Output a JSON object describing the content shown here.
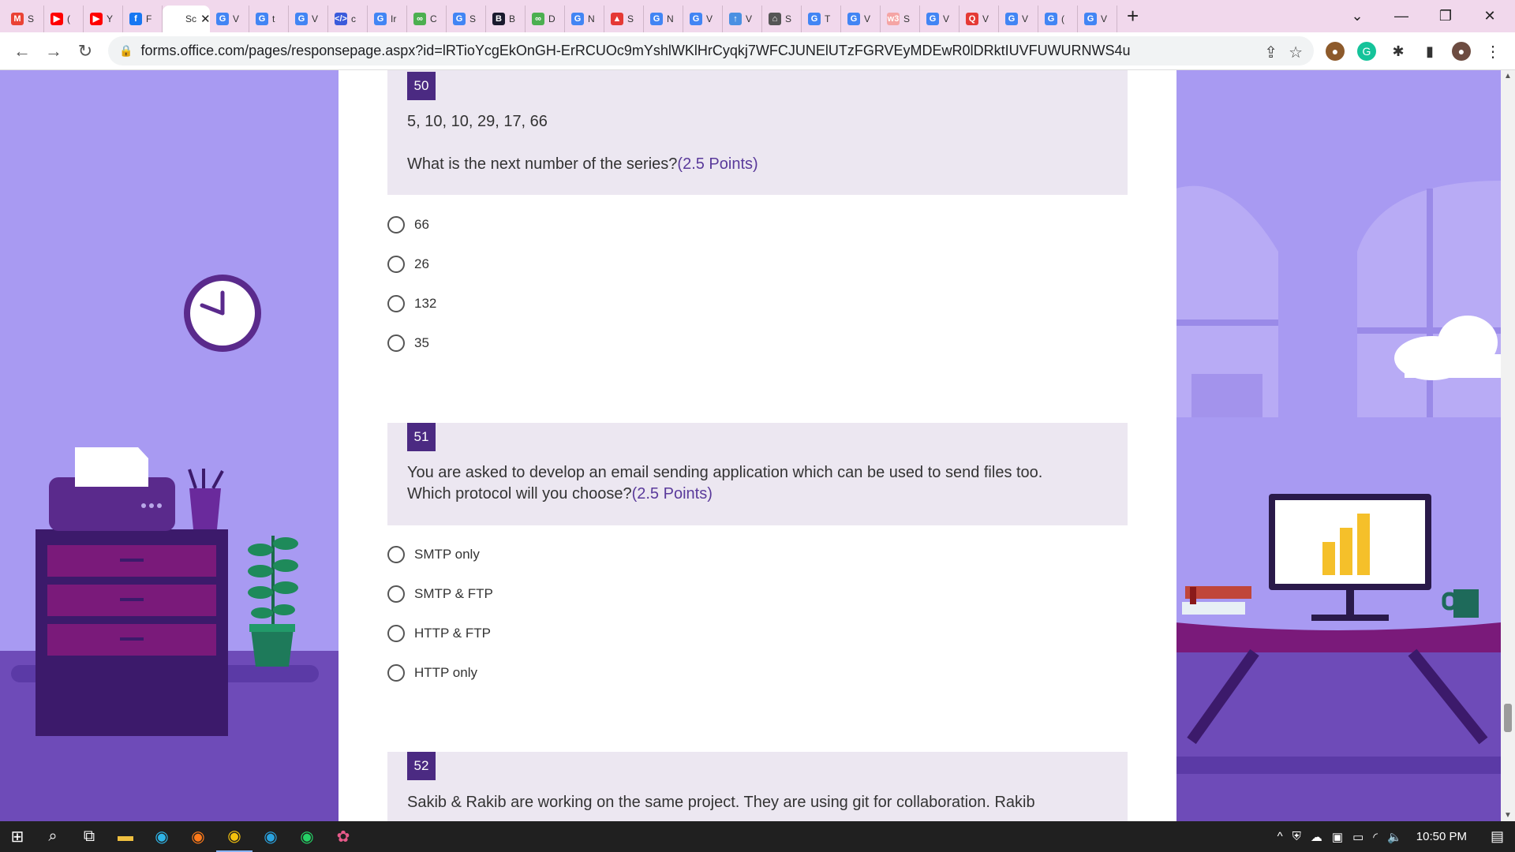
{
  "browser": {
    "tabs": [
      {
        "fav": "M",
        "color": "#ea4335",
        "label": "S"
      },
      {
        "fav": "▶",
        "color": "#ff0000",
        "label": "("
      },
      {
        "fav": "▶",
        "color": "#ff0000",
        "label": "Y"
      },
      {
        "fav": "f",
        "color": "#1877f2",
        "label": "F"
      },
      {
        "fav": "",
        "color": "#ffffff",
        "label": "Sc",
        "active": true
      },
      {
        "fav": "G",
        "color": "#4285f4",
        "label": "V"
      },
      {
        "fav": "G",
        "color": "#4285f4",
        "label": "t"
      },
      {
        "fav": "G",
        "color": "#4285f4",
        "label": "V"
      },
      {
        "fav": "</>",
        "color": "#3b5bdb",
        "label": "c"
      },
      {
        "fav": "G",
        "color": "#4285f4",
        "label": "Ir"
      },
      {
        "fav": "∞",
        "color": "#4caf50",
        "label": "C"
      },
      {
        "fav": "G",
        "color": "#4285f4",
        "label": "S"
      },
      {
        "fav": "B",
        "color": "#1a1a2e",
        "label": "B"
      },
      {
        "fav": "∞",
        "color": "#4caf50",
        "label": "D"
      },
      {
        "fav": "G",
        "color": "#4285f4",
        "label": "N"
      },
      {
        "fav": "▲",
        "color": "#e53935",
        "label": "S"
      },
      {
        "fav": "G",
        "color": "#4285f4",
        "label": "N"
      },
      {
        "fav": "G",
        "color": "#4285f4",
        "label": "V"
      },
      {
        "fav": "↑",
        "color": "#4a90e2",
        "label": "V"
      },
      {
        "fav": "⌂",
        "color": "#555555",
        "label": "S"
      },
      {
        "fav": "G",
        "color": "#4285f4",
        "label": "T"
      },
      {
        "fav": "G",
        "color": "#4285f4",
        "label": "V"
      },
      {
        "fav": "w3",
        "color": "#f5a5a5",
        "label": "S"
      },
      {
        "fav": "G",
        "color": "#4285f4",
        "label": "V"
      },
      {
        "fav": "Q",
        "color": "#e53935",
        "label": "V"
      },
      {
        "fav": "G",
        "color": "#4285f4",
        "label": "V"
      },
      {
        "fav": "G",
        "color": "#4285f4",
        "label": "("
      },
      {
        "fav": "G",
        "color": "#4285f4",
        "label": "V"
      }
    ],
    "url": "forms.office.com/pages/responsepage.aspx?id=lRTioYcgEkOnGH-ErRCUOc9mYshlWKlHrCyqkj7WFCJUNElUTzFGRVEyMDEwR0lDRktIUVFUWURNWS4u"
  },
  "questions": [
    {
      "number": "50",
      "lines": [
        "5, 10, 10, 29, 17, 66",
        "What is the next number of the series?"
      ],
      "points": "(2.5 Points)",
      "options": [
        "66",
        "26",
        "132",
        "35"
      ]
    },
    {
      "number": "51",
      "lines": [
        "You are asked to develop an email sending application which can be used to send files too.",
        "Which protocol will you choose?"
      ],
      "points": "(2.5 Points)",
      "options": [
        "SMTP only",
        "SMTP & FTP",
        "HTTP & FTP",
        "HTTP only"
      ]
    },
    {
      "number": "52",
      "lines": [
        "Sakib & Rakib are working on the same project. They are using git for collaboration. Rakib"
      ],
      "points": "",
      "options": []
    }
  ],
  "taskbar": {
    "time": "10:50 PM"
  }
}
